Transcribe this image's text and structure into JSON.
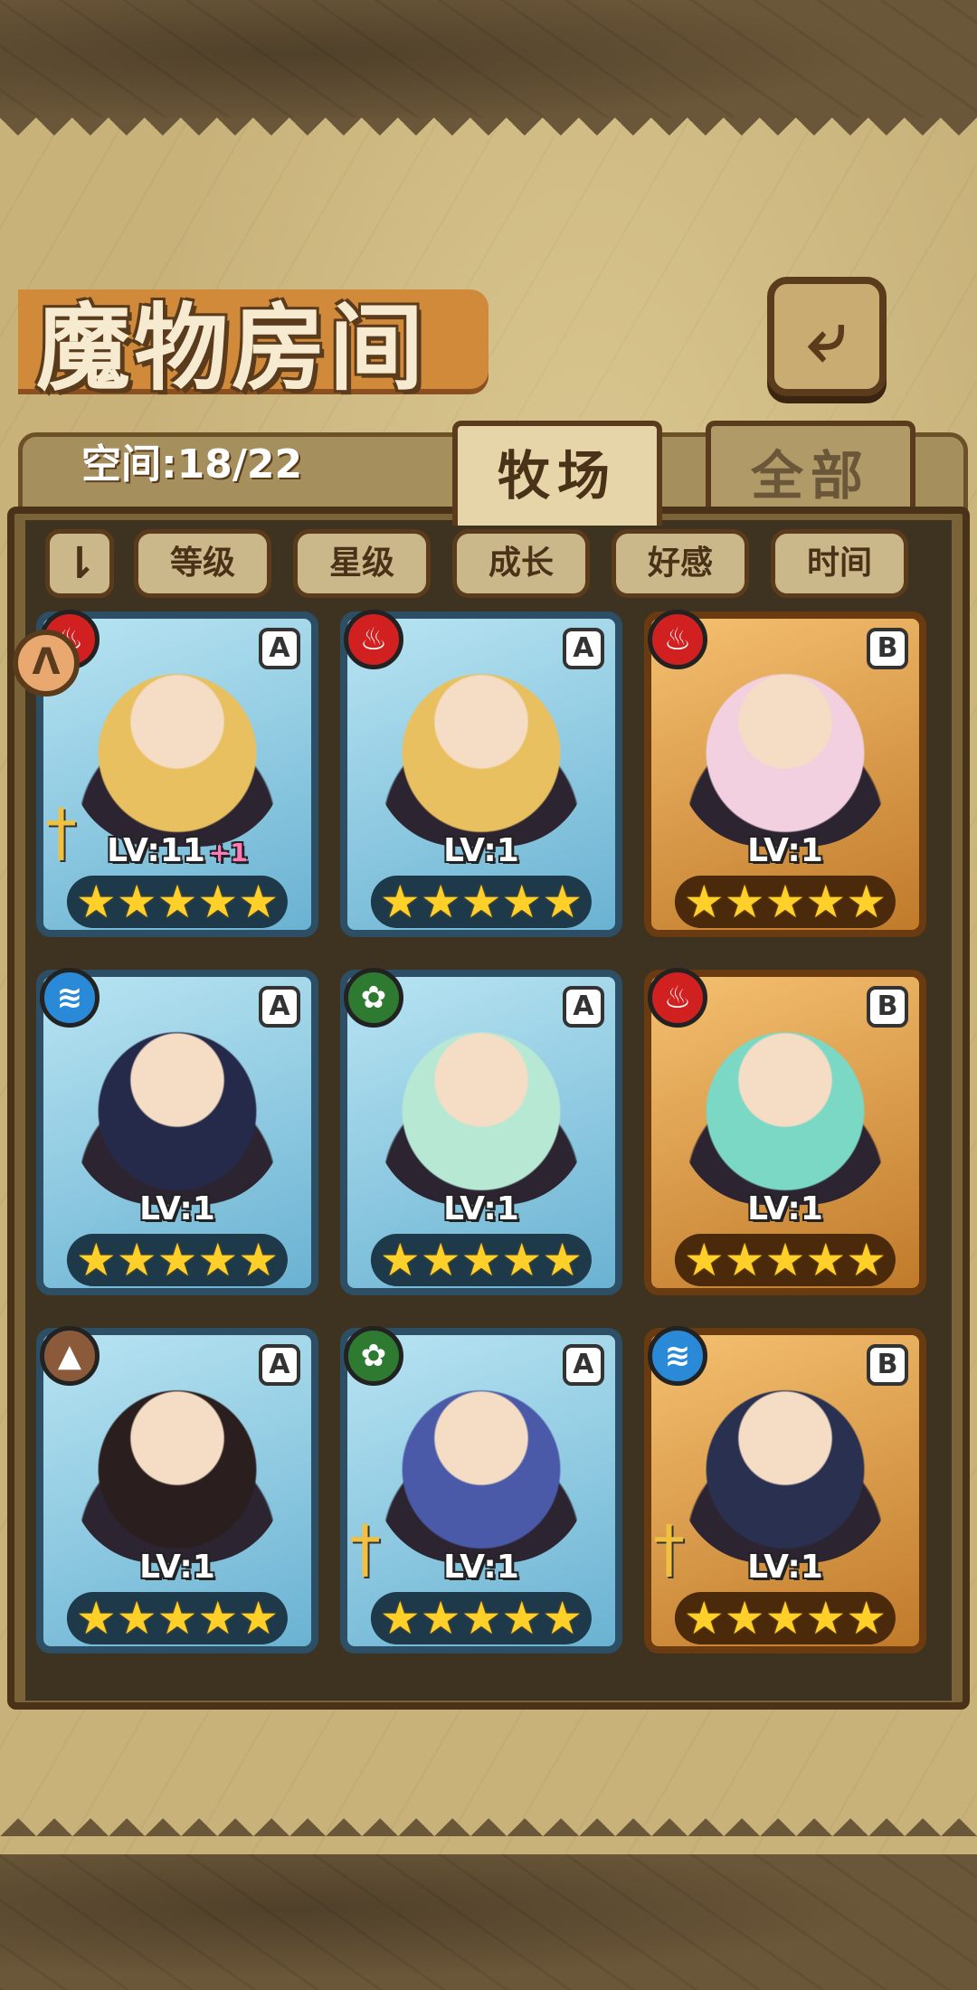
{
  "header": {
    "title": "魔物房间",
    "back_icon": "back-arrow-icon"
  },
  "tabs": {
    "space": "空间:18/22",
    "active": "牧场",
    "inactive": "全部"
  },
  "sort": {
    "toggle_icon": "sort-order-icon",
    "toggle_glyph": "⇂",
    "buttons": [
      "等级",
      "星级",
      "成长",
      "好感",
      "时间"
    ]
  },
  "side_badge": {
    "icon": "notification-arrow-icon",
    "glyph": "ᐱ"
  },
  "cards": [
    {
      "element": "fire",
      "element_glyph": "♨",
      "element_color": "#d02020",
      "rank": "A",
      "level": "LV:11",
      "bonus": "+1",
      "stars": 5,
      "hair": "#e8c060",
      "weapon": true
    },
    {
      "element": "fire",
      "element_glyph": "♨",
      "element_color": "#d02020",
      "rank": "A",
      "level": "LV:1",
      "bonus": "",
      "stars": 5,
      "hair": "#e8c060",
      "weapon": false
    },
    {
      "element": "fire",
      "element_glyph": "♨",
      "element_color": "#d02020",
      "rank": "B",
      "level": "LV:1",
      "bonus": "",
      "stars": 5,
      "hair": "#f2d0e0",
      "weapon": false
    },
    {
      "element": "water",
      "element_glyph": "≋",
      "element_color": "#2a8ad8",
      "rank": "A",
      "level": "LV:1",
      "bonus": "",
      "stars": 5,
      "hair": "#262a4a",
      "weapon": false
    },
    {
      "element": "wood",
      "element_glyph": "✿",
      "element_color": "#2e7a30",
      "rank": "A",
      "level": "LV:1",
      "bonus": "",
      "stars": 5,
      "hair": "#b6e8d4",
      "weapon": false
    },
    {
      "element": "fire",
      "element_glyph": "♨",
      "element_color": "#d02020",
      "rank": "B",
      "level": "LV:1",
      "bonus": "",
      "stars": 5,
      "hair": "#7ad8c4",
      "weapon": false
    },
    {
      "element": "earth",
      "element_glyph": "▲",
      "element_color": "#8a5a3a",
      "rank": "A",
      "level": "LV:1",
      "bonus": "",
      "stars": 5,
      "hair": "#2a1e1e",
      "weapon": false
    },
    {
      "element": "wood",
      "element_glyph": "✿",
      "element_color": "#2e7a30",
      "rank": "A",
      "level": "LV:1",
      "bonus": "",
      "stars": 5,
      "hair": "#4a5aa8",
      "weapon": true
    },
    {
      "element": "water",
      "element_glyph": "≋",
      "element_color": "#2a8ad8",
      "rank": "B",
      "level": "LV:1",
      "bonus": "",
      "stars": 5,
      "hair": "#2a3050",
      "weapon": true
    }
  ]
}
